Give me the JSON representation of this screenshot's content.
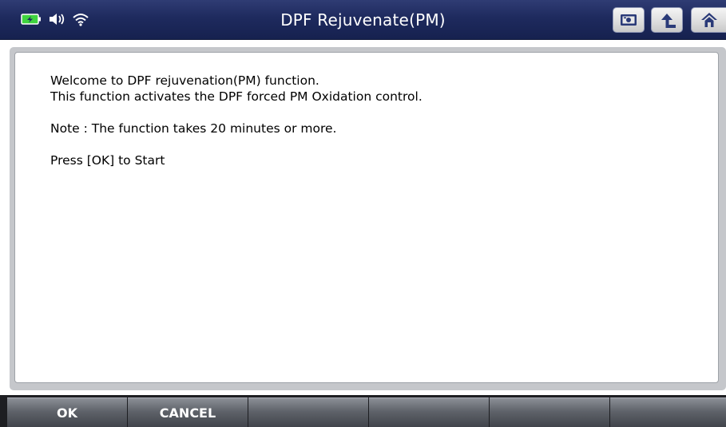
{
  "window": {
    "title": "DPF Rejuvenate(PM)"
  },
  "status_bar": {
    "icons": [
      "battery-charging-icon",
      "speaker-icon",
      "wifi-icon"
    ]
  },
  "nav_buttons": {
    "icons": [
      "screen-capture-icon",
      "back-arrow-icon",
      "home-icon"
    ]
  },
  "message": {
    "line1": "Welcome to DPF rejuvenation(PM) function.",
    "line2": "This function activates the DPF forced PM Oxidation control.",
    "note": "Note : The function takes 20 minutes or more.",
    "prompt": "Press [OK] to Start"
  },
  "function_bar": {
    "buttons": [
      {
        "label": "OK"
      },
      {
        "label": "CANCEL"
      },
      {
        "label": ""
      },
      {
        "label": ""
      },
      {
        "label": ""
      },
      {
        "label": ""
      }
    ]
  },
  "colors": {
    "titlebar": "#1e2a5e",
    "battery": "#3fd43f",
    "funcbar": "#1d1e22"
  }
}
